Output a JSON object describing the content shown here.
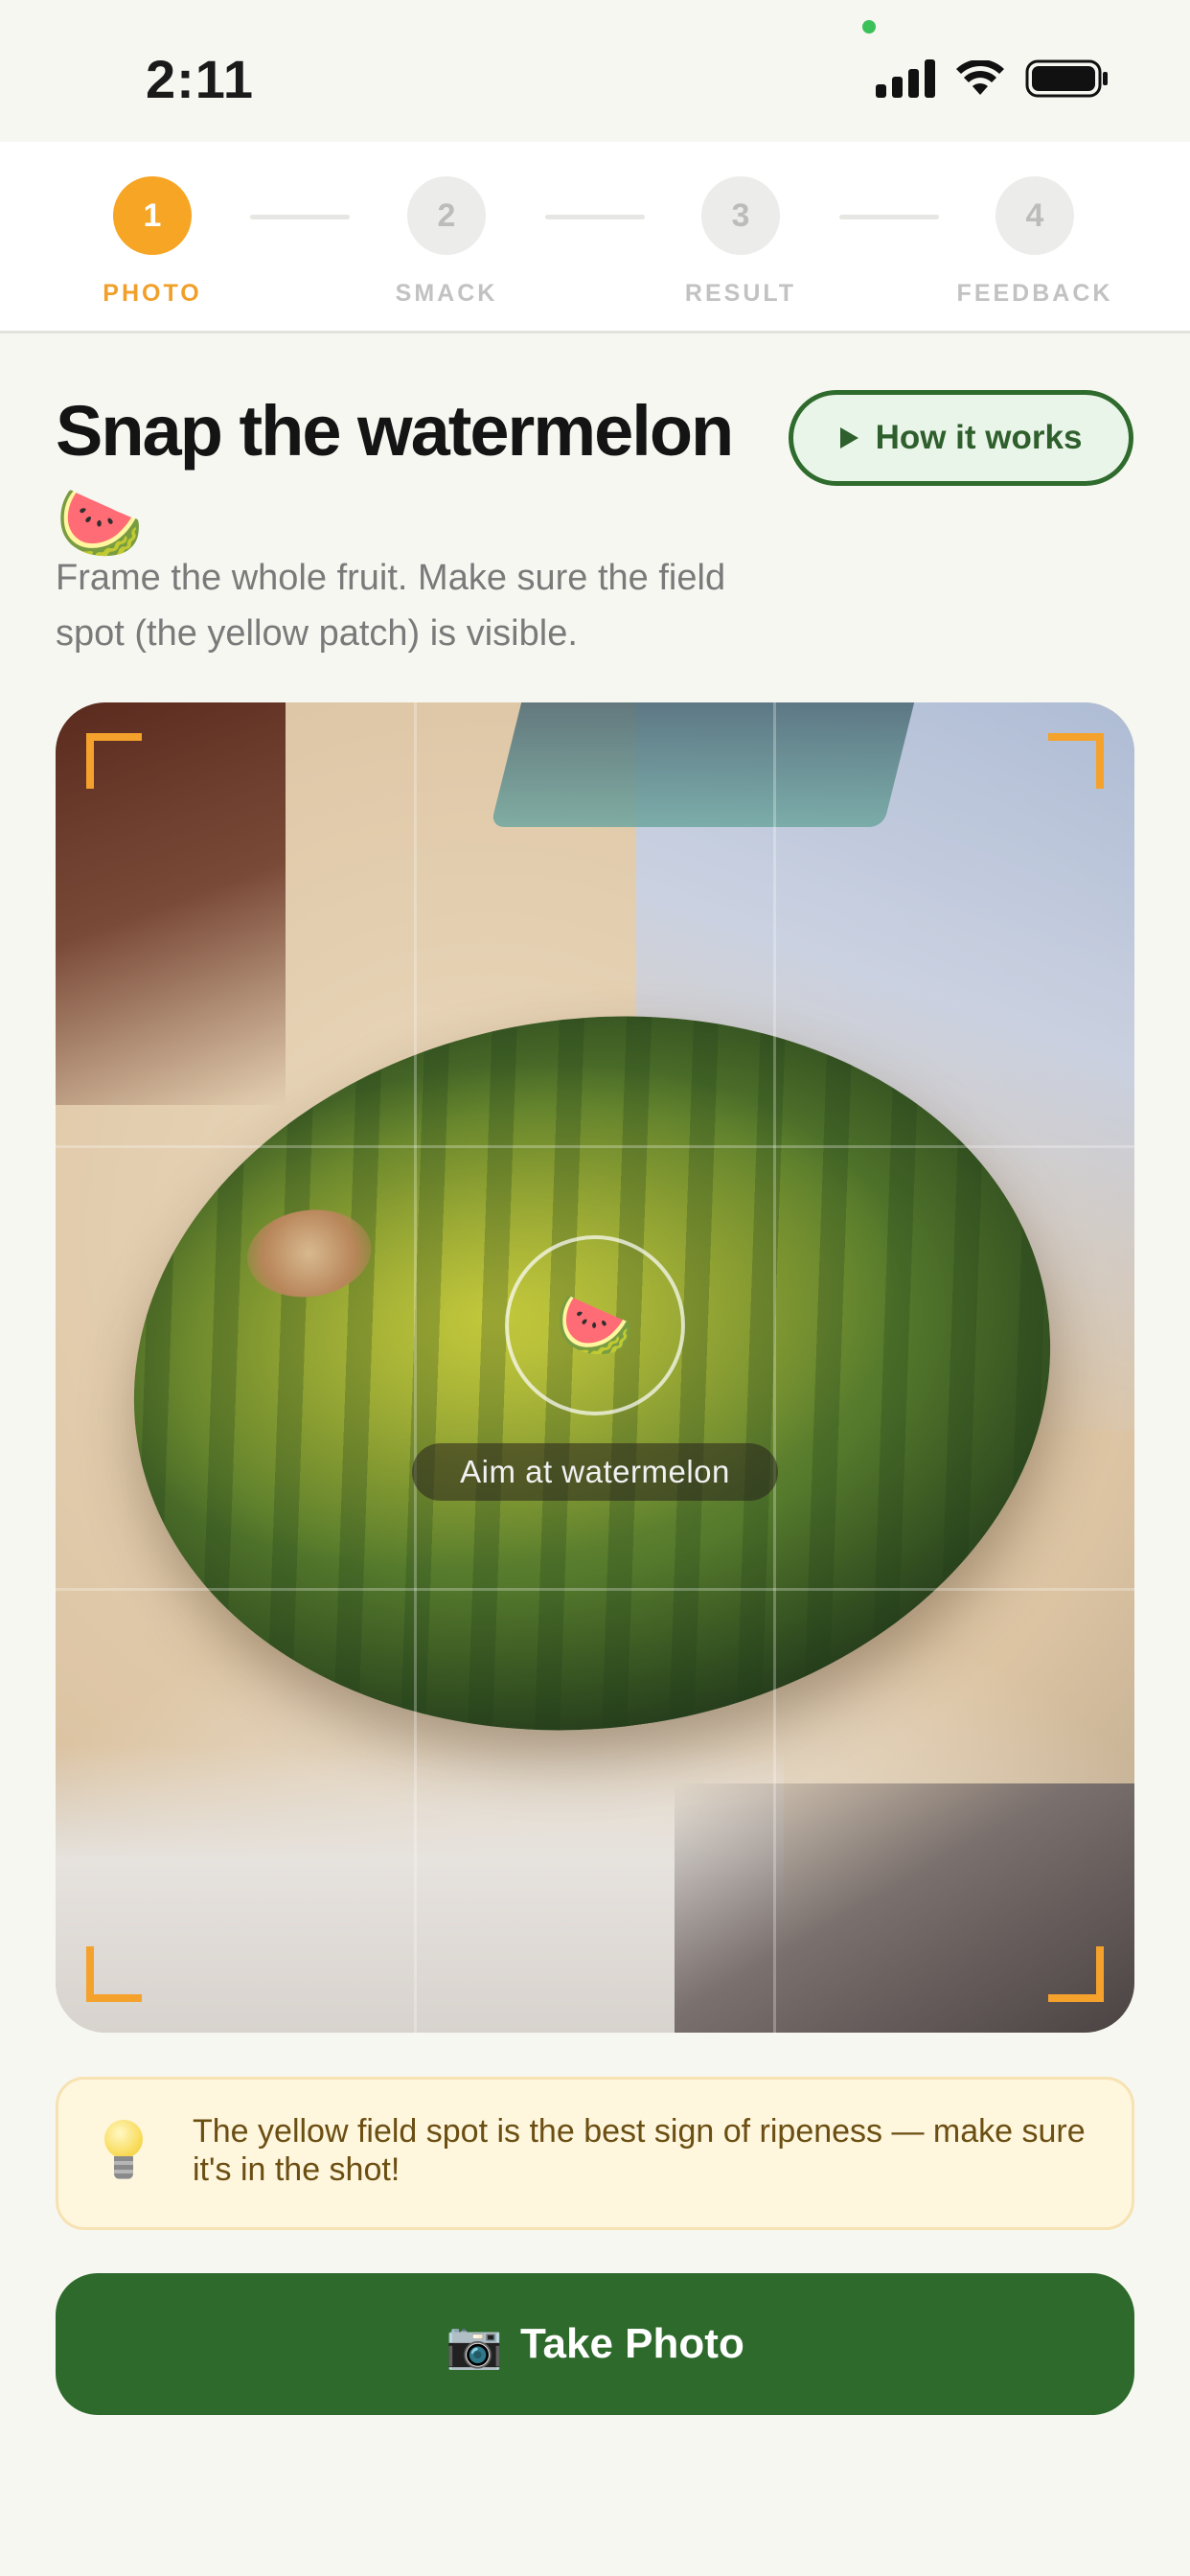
{
  "status_bar": {
    "time": "2:11"
  },
  "stepper": {
    "steps": [
      {
        "number": "1",
        "label": "PHOTO",
        "active": true
      },
      {
        "number": "2",
        "label": "SMACK",
        "active": false
      },
      {
        "number": "3",
        "label": "RESULT",
        "active": false
      },
      {
        "number": "4",
        "label": "FEEDBACK",
        "active": false
      }
    ]
  },
  "header": {
    "title": "Snap the watermelon 🍉",
    "how_it_works_label": "How it works",
    "subtitle": "Frame the whole fruit. Make sure the field spot (the yellow patch) is visible."
  },
  "camera": {
    "target_emoji": "🍉",
    "aim_hint": "Aim at watermelon"
  },
  "tip": {
    "icon": "lightbulb-icon",
    "text": "The yellow field spot is the best sign of ripeness — make sure it's in the shot!"
  },
  "actions": {
    "take_photo_emoji": "📷",
    "take_photo_label": "Take Photo"
  },
  "colors": {
    "accent_orange": "#f6a524",
    "primary_green": "#2d6a2b",
    "tip_background": "#fef6dd"
  }
}
